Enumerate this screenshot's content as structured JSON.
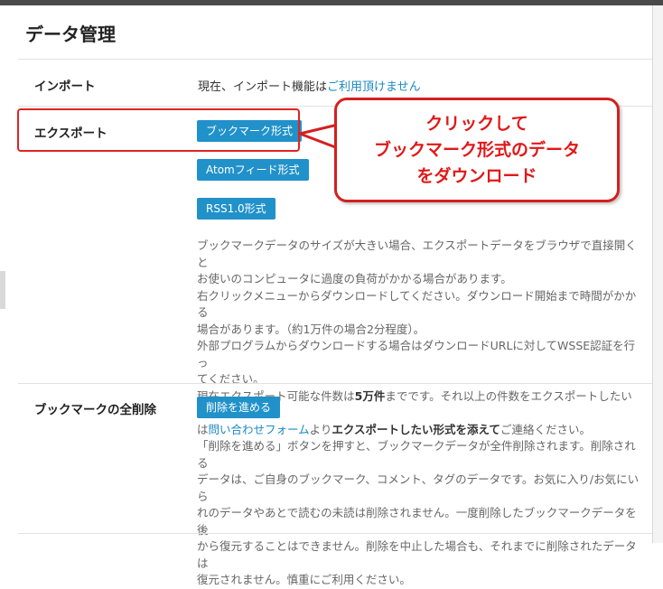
{
  "page": {
    "title": "データ管理"
  },
  "import": {
    "label": "インポート",
    "text": "現在、インポート機能は",
    "link": "ご利用頂けません"
  },
  "export": {
    "label": "エクスポート",
    "buttons": [
      "ブックマーク形式",
      "Atomフィード形式",
      "RSS1.0形式"
    ],
    "desc": {
      "line1": "ブックマークデータのサイズが大きい場合、エクスポートデータをブラウザで直接開くと",
      "line2": "お使いのコンピュータに過度の負荷がかかる場合があります。",
      "line3": "右クリックメニューからダウンロードしてください。ダウンロード開始まで時間がかかる",
      "line4": "場合があります。（約1万件の場合2分程度）。",
      "line5": "外部プログラムからダウンロードする場合はダウンロードURLに対してWSSE認証を行っ",
      "line6": "てください。",
      "line7_a": "現在エクスポート可能な件数は",
      "line7_b": "5万件",
      "line7_c": "までです。それ以上の件数をエクスポートしたい場合",
      "line8_a": "は",
      "line8_link": "問い合わせフォーム",
      "line8_b": "より",
      "line8_c": "エクスポートしたい形式を添えて",
      "line8_d": "ご連絡ください。"
    }
  },
  "delete": {
    "label": "ブックマークの全削除",
    "button": "削除を進める",
    "desc": {
      "line1": "「削除を進める」ボタンを押すと、ブックマークデータが全件削除されます。削除される",
      "line2": "データは、ご自身のブックマーク、コメント、タグのデータです。お気に入り/お気にいら",
      "line3": "れのデータやあとで読むの未読は削除されません。一度削除したブックマークデータを後",
      "line4": "から復元することはできません。削除を中止した場合も、それまでに削除されたデータは",
      "line5": "復元されません。慎重にご利用ください。"
    }
  },
  "annotation": {
    "line1": "クリックして",
    "line2": "ブックマーク形式のデータ",
    "line3": "をダウンロード",
    "color": "#e01818"
  },
  "colors": {
    "accent": "#2191c9",
    "link": "#1a89c2",
    "annotation_border": "#d42020"
  }
}
